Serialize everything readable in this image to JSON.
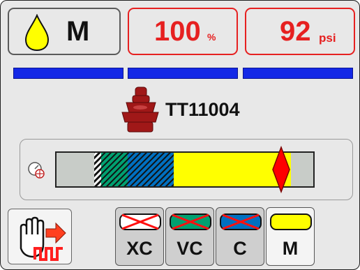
{
  "mode": {
    "label": "M",
    "drop_color": "#ffff00"
  },
  "rate": {
    "value": "100",
    "unit": "%"
  },
  "pressure": {
    "value": "92",
    "unit": "psi"
  },
  "section_bars": {
    "count": 3,
    "color": "#1428e6"
  },
  "nozzle": {
    "name": "TT11004",
    "icon": "nozzle-icon",
    "color": "#a01818"
  },
  "gauge": {
    "marker_color": "#ff0000",
    "segments": [
      {
        "class": "XC",
        "color": "#ffffff"
      },
      {
        "class": "VC",
        "color": "#00a070"
      },
      {
        "class": "C",
        "color": "#0070c0"
      },
      {
        "class": "M",
        "color": "#ffff00"
      }
    ]
  },
  "droplet_buttons": [
    {
      "label": "XC",
      "swatch": "#ffffff",
      "crossed": true
    },
    {
      "label": "VC",
      "swatch": "#00a070",
      "crossed": true
    },
    {
      "label": "C",
      "swatch": "#0070c0",
      "crossed": true
    },
    {
      "label": "M",
      "swatch": "#ffff00",
      "crossed": false
    }
  ],
  "icons": {
    "stop_pulse": "hand-stop-pulse-icon",
    "gauge_dial": "gauge-dial-icon"
  }
}
